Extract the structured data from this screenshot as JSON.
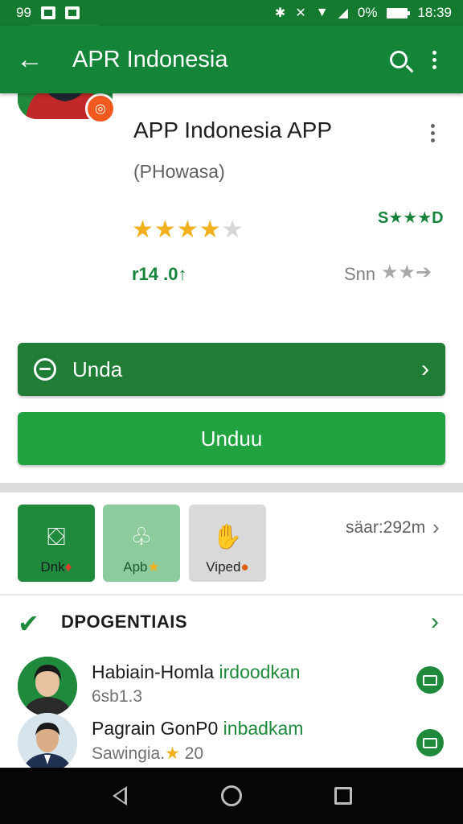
{
  "status_bar": {
    "left_text": "99",
    "battery": "0%",
    "time": "18:39"
  },
  "app_bar": {
    "title": "APR Indonesia"
  },
  "app": {
    "name": "APP Indonesia APP",
    "developer": "(PHowasa)",
    "rating_stars": 4,
    "rating_max": 5,
    "green_rating_text": "S★★★D",
    "downloads_text": "r14 .0↑",
    "similar_label": "Snn",
    "similar_stars": "★★➔"
  },
  "buttons": {
    "secondary_label": "Unda",
    "install_label": "Unduu"
  },
  "tiles": [
    {
      "label": "Dnk",
      "icon": "⛋",
      "badge": "♦"
    },
    {
      "label": "Apb",
      "icon": "♧",
      "badge": "★"
    },
    {
      "label": "Viped",
      "icon": "✋",
      "badge": "●"
    }
  ],
  "size_info": "säar:292m",
  "section": {
    "title": "DPOGENTIAIS"
  },
  "reviews": [
    {
      "name": "Habiain-Homla",
      "name_highlight": "irdoodkan",
      "sub": "6sb1.3",
      "sub_star": ""
    },
    {
      "name": "Pagrain GonP0",
      "name_highlight": "inbadkam",
      "sub": "Sawingia.",
      "sub_star": "★",
      "sub_after": "20"
    }
  ],
  "colors": {
    "brand_green": "#138438",
    "button_green": "#21a340",
    "star": "#f2b01e"
  }
}
